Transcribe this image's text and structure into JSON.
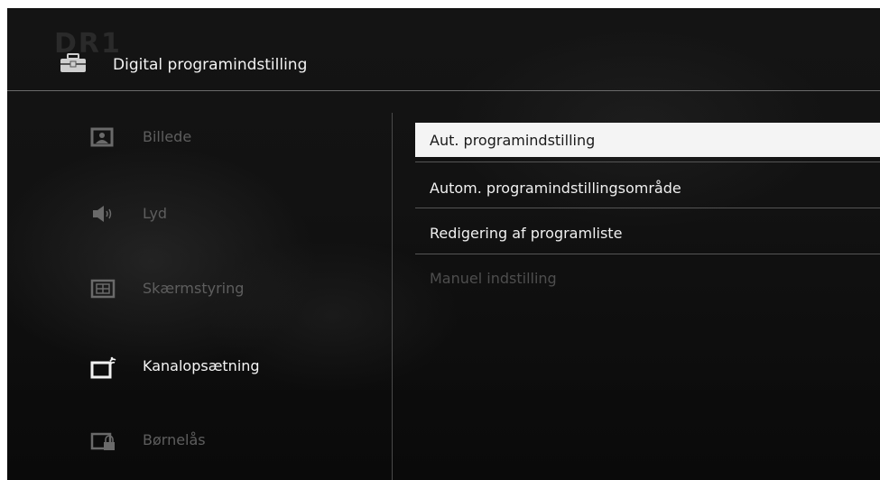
{
  "header": {
    "title": "Digital programindstilling",
    "icon": "toolbox-icon"
  },
  "background": {
    "watermark": "DR1"
  },
  "categories": [
    {
      "label": "Billede",
      "icon": "picture-icon",
      "active": false
    },
    {
      "label": "Lyd",
      "icon": "speaker-icon",
      "active": false
    },
    {
      "label": "Skærmstyring",
      "icon": "screen-control-icon",
      "active": false
    },
    {
      "label": "Kanalopsætning",
      "icon": "channel-setup-icon",
      "active": true
    },
    {
      "label": "Børnelås",
      "icon": "parental-lock-icon",
      "active": false
    }
  ],
  "options": [
    {
      "label": "Aut. programindstilling",
      "state": "selected"
    },
    {
      "label": "Autom. programindstillingsområde",
      "state": "normal"
    },
    {
      "label": "Redigering af programliste",
      "state": "normal"
    },
    {
      "label": "Manuel indstilling",
      "state": "disabled"
    }
  ],
  "colors": {
    "highlight": "#f4f4f4",
    "active_text": "#f5f5f5",
    "inactive_text": "#5e5e5e",
    "disabled_text": "#4e4e4e"
  }
}
